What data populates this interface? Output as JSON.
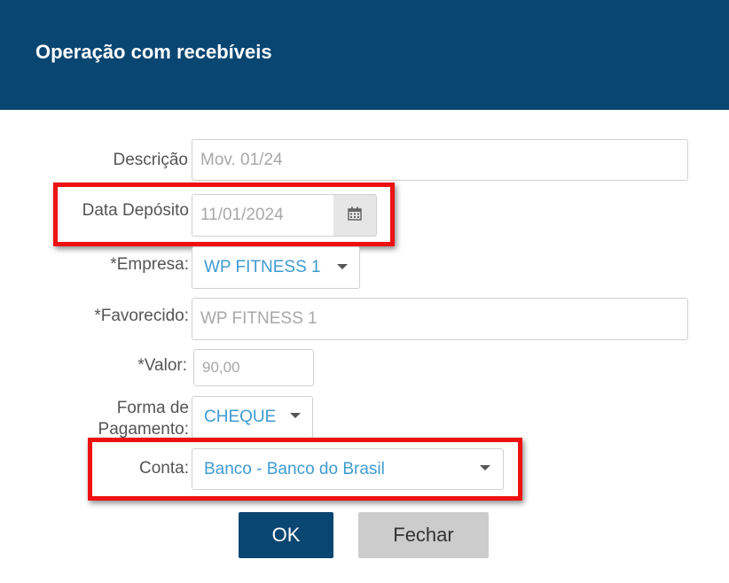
{
  "dialog": {
    "title": "Operação com recebíveis"
  },
  "form": {
    "descricao": {
      "label": "Descrição",
      "placeholder": "Mov. 01/24"
    },
    "data_deposito": {
      "label": "Data Depósito",
      "value": "11/01/2024",
      "icon": "calendar-icon"
    },
    "empresa": {
      "label": "*Empresa:",
      "value": "WP FITNESS 1"
    },
    "favorecido": {
      "label": "*Favorecido:",
      "value": "WP FITNESS 1"
    },
    "valor": {
      "label": "*Valor:",
      "value": "90,00"
    },
    "forma_pagamento": {
      "label_line1": "Forma de",
      "label_line2": "Pagamento:",
      "value": "CHEQUE"
    },
    "conta": {
      "label": "Conta:",
      "value": "Banco - Banco do Brasil"
    }
  },
  "buttons": {
    "ok": "OK",
    "close": "Fechar"
  },
  "colors": {
    "header": "#0a4672",
    "highlight": "#ee1111",
    "select_text": "#3e9bd1",
    "ok_button": "#0a4672",
    "close_button": "#cccccc"
  }
}
